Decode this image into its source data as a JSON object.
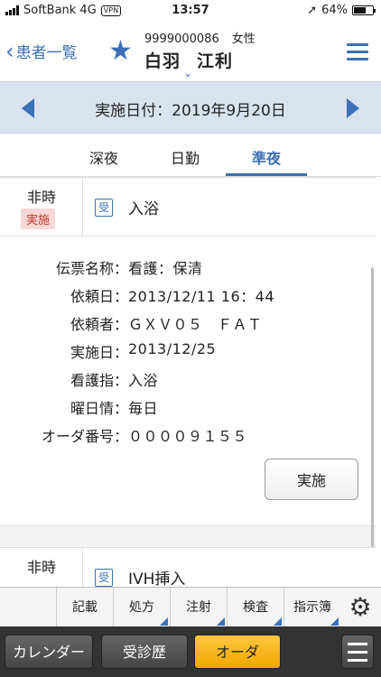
{
  "status": {
    "carrier": "SoftBank 4G",
    "vpn": "VPN",
    "time": "13:57",
    "battery": "64%",
    "battery_level": 0.64
  },
  "header": {
    "back_label": "患者一覧",
    "patient_id": "9999000086",
    "sex": "女性",
    "family_name": "白羽",
    "given_name": "江利"
  },
  "datebar": {
    "date": "実施日付：2019年9月20日"
  },
  "tabs": [
    {
      "label": "深夜"
    },
    {
      "label": "日勤"
    },
    {
      "label": "準夜",
      "active": true
    }
  ],
  "orders": [
    {
      "time": "非時",
      "badge": "実施",
      "kind_icon": "受",
      "title": "入浴",
      "details": [
        {
          "label": "伝票名称",
          "value": "看護：保清"
        },
        {
          "label": "依頼日",
          "value": "2013/12/11 16：44"
        },
        {
          "label": "依頼者",
          "value": "ＧＸＶ０５　ＦＡＴ"
        },
        {
          "label": "実施日",
          "value": "2013/12/25"
        },
        {
          "label": "看護指",
          "value": "入浴"
        },
        {
          "label": "曜日情",
          "value": "毎日"
        },
        {
          "label": "オーダ番号",
          "value": "００００９１５５"
        }
      ],
      "action_label": "実施"
    },
    {
      "time": "非時",
      "kind_icon": "受",
      "title": "IVH挿入"
    }
  ],
  "toolbar": [
    {
      "label": "記載"
    },
    {
      "label": "処方"
    },
    {
      "label": "注射"
    },
    {
      "label": "検査"
    },
    {
      "label": "指示簿"
    }
  ],
  "bottomnav": [
    {
      "label": "カレンダー"
    },
    {
      "label": "受診歴"
    },
    {
      "label": "オーダ",
      "active": true
    }
  ],
  "icons": {
    "back": "chevron-left-icon",
    "favorite": "star-icon",
    "expand": "chevron-down-icon",
    "menu": "hamburger-icon",
    "settings": "gear-icon"
  },
  "colors": {
    "accent": "#3b6fb6",
    "date_bar": "#d9e2ef",
    "badge_bg": "#f8d7d6",
    "active_nav": "#f0a800"
  }
}
